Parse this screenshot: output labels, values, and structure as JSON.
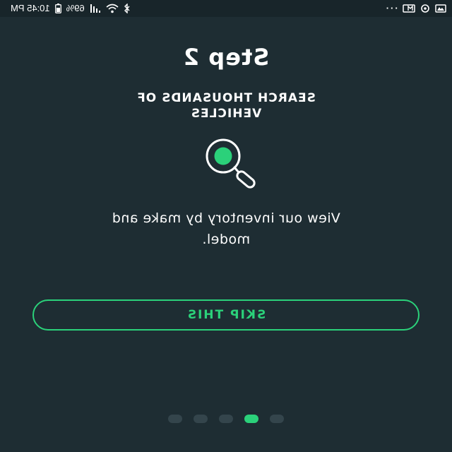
{
  "status_bar": {
    "time": "10:45 PM",
    "battery_percent": "69%",
    "icons": [
      "bluetooth-icon",
      "wifi-icon",
      "signal-icon",
      "battery-icon",
      "more-icon",
      "sim-icon",
      "sync-icon",
      "screenshot-icon"
    ]
  },
  "onboarding": {
    "step_title": "Step 2",
    "subtitle": "SEARCH THOUSANDS OF VEHICLES",
    "illustration_icon": "magnifying-glass-icon",
    "description": "View our inventory by make and model.",
    "skip_label": "SKIP THIS",
    "pagination": {
      "total": 5,
      "current": 2
    }
  },
  "colors": {
    "background": "#1e2d33",
    "accent": "#2bd17a",
    "inactive_dot": "#34454c",
    "text": "#ffffff"
  }
}
